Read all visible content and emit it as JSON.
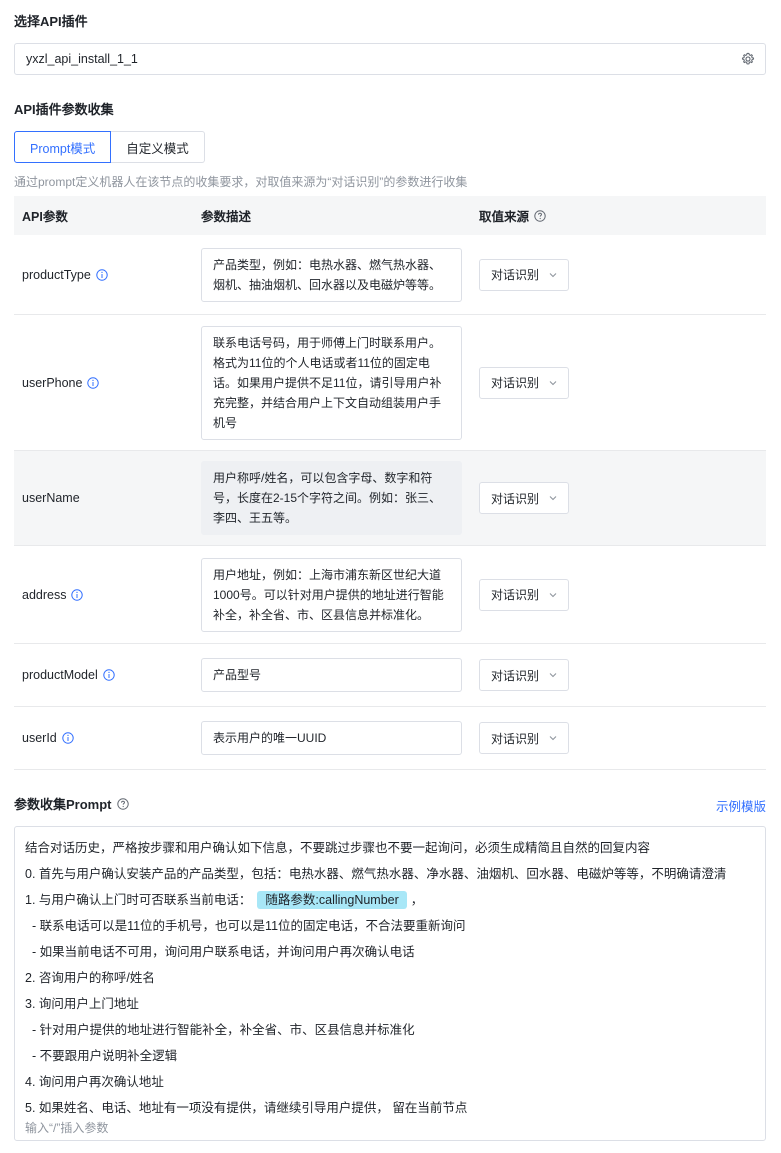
{
  "plugin_section": {
    "title": "选择API插件",
    "selected": "yxzl_api_install_1_1"
  },
  "params_section": {
    "title": "API插件参数收集",
    "tabs": [
      {
        "label": "Prompt模式",
        "active": true
      },
      {
        "label": "自定义模式",
        "active": false
      }
    ],
    "hint": "通过prompt定义机器人在该节点的收集要求，对取值来源为“对话识别”的参数进行收集"
  },
  "table": {
    "headers": {
      "param": "API参数",
      "desc": "参数描述",
      "source": "取值来源"
    },
    "rows": [
      {
        "name": "productType",
        "desc": "产品类型，例如：电热水器、燃气热水器、\n烟机、抽油烟机、回水器以及电磁炉等等。",
        "source": "对话识别"
      },
      {
        "name": "userPhone",
        "desc": "联系电话号码，用于师傅上门时联系用户。\n格式为11位的个人电话或者11位的固定电\n话。如果用户提供不足11位，请引导用户补\n充完整，并结合用户上下文自动组装用户手\n机号",
        "source": "对话识别"
      },
      {
        "name": "userName",
        "desc": "用户称呼/姓名，可以包含字母、数字和符\n号，长度在2-15个字符之间。例如：张三、\n李四、王五等。",
        "source": "对话识别"
      },
      {
        "name": "address",
        "desc": "用户地址，例如：上海市浦东新区世纪大道\n1000号。可以针对用户提供的地址进行智能\n补全，补全省、市、区县信息并标准化。",
        "source": "对话识别"
      },
      {
        "name": "productModel",
        "desc": "产品型号",
        "source": "对话识别"
      },
      {
        "name": "userId",
        "desc": "表示用户的唯一UUID",
        "source": "对话识别"
      }
    ]
  },
  "prompt_section": {
    "title": "参数收集Prompt",
    "example_link": "示例模版",
    "lines": [
      "结合对话历史，严格按步骤和用户确认如下信息，不要跳过步骤也不要一起询问，必须生成精简且自然的回复内容",
      "0. 首先与用户确认安装产品的产品类型，包括：电热水器、燃气热水器、净水器、油烟机、回水器、电磁炉等等，不明确请澄清"
    ],
    "line_with_tag": {
      "before": "1. 与用户确认上门时可否联系当前电话：",
      "tag": "随路参数:callingNumber",
      "after": "，"
    },
    "lines_after": [
      "  - 联系电话可以是11位的手机号，也可以是11位的固定电话，不合法要重新询问",
      "  - 如果当前电话不可用，询问用户联系电话，并询问用户再次确认电话",
      "2. 咨询用户的称呼/姓名",
      "3. 询问用户上门地址",
      "  - 针对用户提供的地址进行智能补全，补全省、市、区县信息并标准化",
      "  - 不要跟用户说明补全逻辑",
      "4. 询问用户再次确认地址",
      "5. 如果姓名、电话、地址有一项没有提供，请继续引导用户提供， 留在当前节点"
    ],
    "placeholder": "输入“/”插入参数"
  },
  "colors": {
    "accent": "#3370ff",
    "tag_bg": "#a8e7f7",
    "header_bg": "#f5f6f7"
  }
}
